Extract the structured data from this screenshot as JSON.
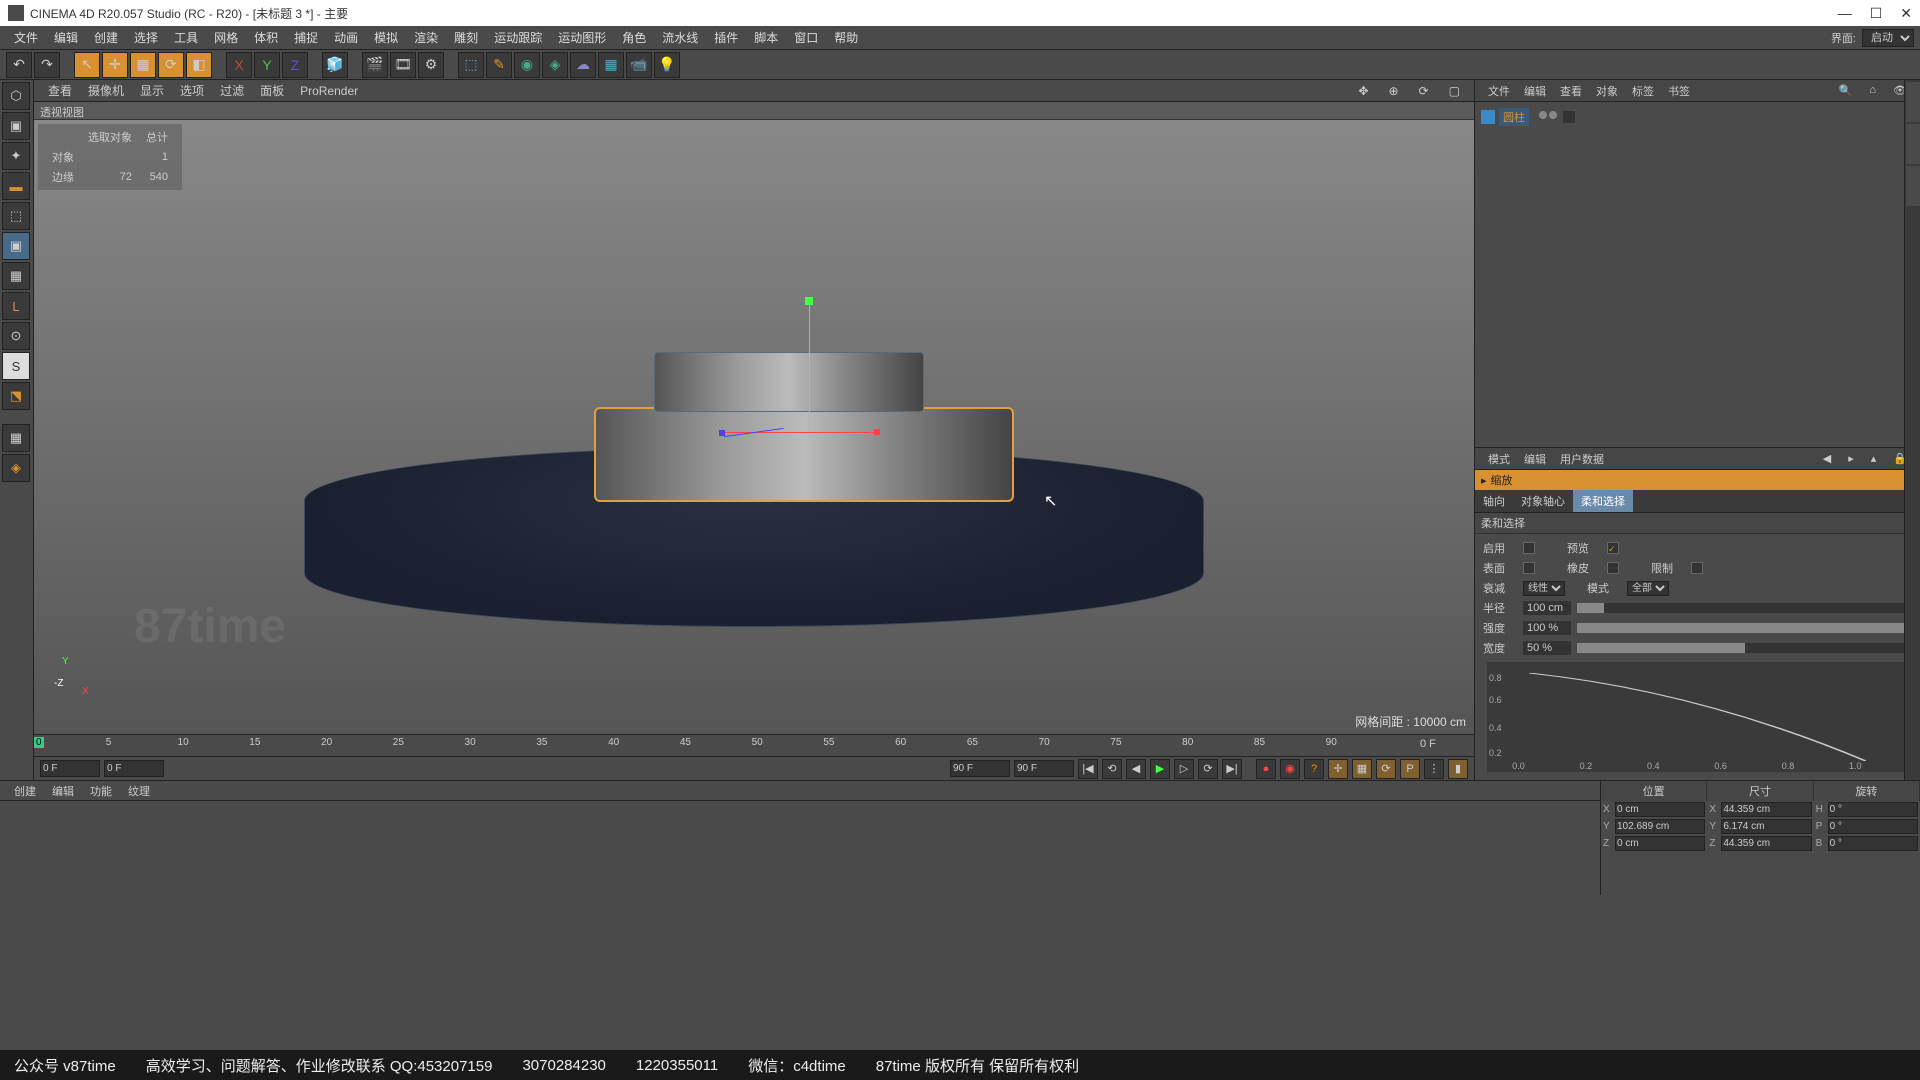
{
  "titlebar": {
    "title": "CINEMA 4D R20.057 Studio (RC - R20) - [未标题 3 *] - 主要"
  },
  "mainmenu": {
    "items": [
      "文件",
      "编辑",
      "创建",
      "选择",
      "工具",
      "网格",
      "体积",
      "捕捉",
      "动画",
      "模拟",
      "渲染",
      "雕刻",
      "运动跟踪",
      "运动图形",
      "角色",
      "流水线",
      "插件",
      "脚本",
      "窗口",
      "帮助"
    ],
    "layout_label": "界面:",
    "layout_value": "启动"
  },
  "viewmenu": {
    "items": [
      "查看",
      "摄像机",
      "显示",
      "选项",
      "过滤",
      "面板",
      "ProRender"
    ],
    "viewname": "透视视图"
  },
  "stats": {
    "header1": "选取对象",
    "header2": "总计",
    "r1": "对象",
    "r1a": "1",
    "r1b": "",
    "r2": "边缘",
    "r2a": "72",
    "r2b": "540"
  },
  "grid_label": "网格间距 : 10000 cm",
  "timeline": {
    "ticks": [
      "0",
      "5",
      "10",
      "15",
      "20",
      "25",
      "30",
      "35",
      "40",
      "45",
      "50",
      "55",
      "60",
      "65",
      "70",
      "75",
      "80",
      "85",
      "90"
    ],
    "end_label": "0 F",
    "start_field": "0 F",
    "start_field2": "0 F",
    "end_field": "90 F",
    "end_field2": "90 F"
  },
  "objpanel": {
    "tabs": [
      "文件",
      "编辑",
      "查看",
      "对象",
      "标签",
      "书签"
    ],
    "objname": "圆柱"
  },
  "attrpanel": {
    "tabs": [
      "模式",
      "编辑",
      "用户数据"
    ],
    "title_prefix": "缩放",
    "subtabs": [
      "轴向",
      "对象轴心",
      "柔和选择"
    ],
    "section": "柔和选择",
    "rows": {
      "enable": "启用",
      "preview": "预览",
      "surface": "表面",
      "rubber": "橡皮",
      "limit": "限制",
      "falloff": "衰减",
      "falloff_val": "线性",
      "mode": "模式",
      "mode_val": "全部",
      "radius": "半径",
      "radius_val": "100 cm",
      "strength": "强度",
      "strength_val": "100 %",
      "width": "宽度",
      "width_val": "50 %"
    },
    "graph": {
      "y": [
        "0.8",
        "0.6",
        "0.4",
        "0.2"
      ],
      "x": [
        "0.0",
        "0.2",
        "0.4",
        "0.6",
        "0.8",
        "1.0"
      ]
    }
  },
  "matmenu": [
    "创建",
    "编辑",
    "功能",
    "纹理"
  ],
  "coords": {
    "headers": [
      "位置",
      "尺寸",
      "旋转"
    ],
    "pos": {
      "X": "0 cm",
      "Y": "102.689 cm",
      "Z": "0 cm"
    },
    "size": {
      "X": "44.359 cm",
      "Y": "6.174 cm",
      "Z": "44.359 cm"
    },
    "rot": {
      "H": "0 °",
      "P": "0 °",
      "B": "0 °"
    }
  },
  "footer": {
    "a": "公众号 v87time",
    "b": "高效学习、问题解答、作业修改联系 QQ:453207159",
    "c": "3070284230",
    "d": "1220355011",
    "e": "微信：c4dtime",
    "f": "87time 版权所有  保留所有权利"
  }
}
